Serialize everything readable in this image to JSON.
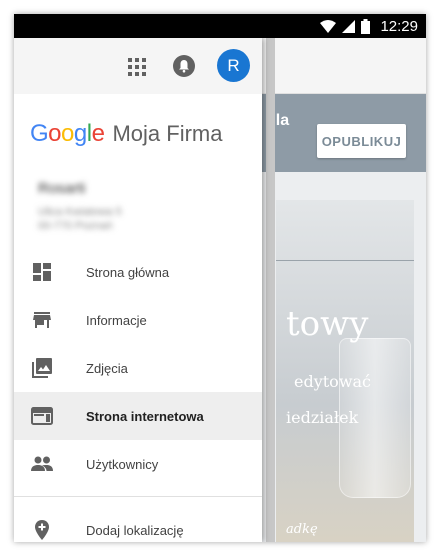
{
  "status_bar": {
    "time": "12:29"
  },
  "background": {
    "header_text": "dla",
    "publish_label": "OPUBLIKUJ",
    "card_title": "towy",
    "card_line1": "edytować",
    "card_line2": "iedziałek",
    "card_line3": "adkę"
  },
  "drawer": {
    "avatar_letter": "R",
    "logo_text": [
      "G",
      "o",
      "o",
      "g",
      "l",
      "e"
    ],
    "product_name": "Moja Firma",
    "business_name": "Rosarti",
    "business_address_line1": "Ulica Kwiatowa 5",
    "business_address_line2": "00-770 Poznań",
    "menu": [
      {
        "label": "Strona główna",
        "icon": "dashboard-icon"
      },
      {
        "label": "Informacje",
        "icon": "store-icon"
      },
      {
        "label": "Zdjęcia",
        "icon": "photos-icon"
      },
      {
        "label": "Strona internetowa",
        "icon": "web-icon",
        "active": true
      },
      {
        "label": "Użytkownicy",
        "icon": "people-icon"
      }
    ],
    "extra": {
      "label": "Dodaj lokalizację",
      "icon": "add-location-icon"
    }
  },
  "colors": {
    "accent": "#1976d2",
    "header_bg": "#8e9ba6",
    "active_item_bg": "#eeeeee",
    "icon_gray": "#616161"
  }
}
